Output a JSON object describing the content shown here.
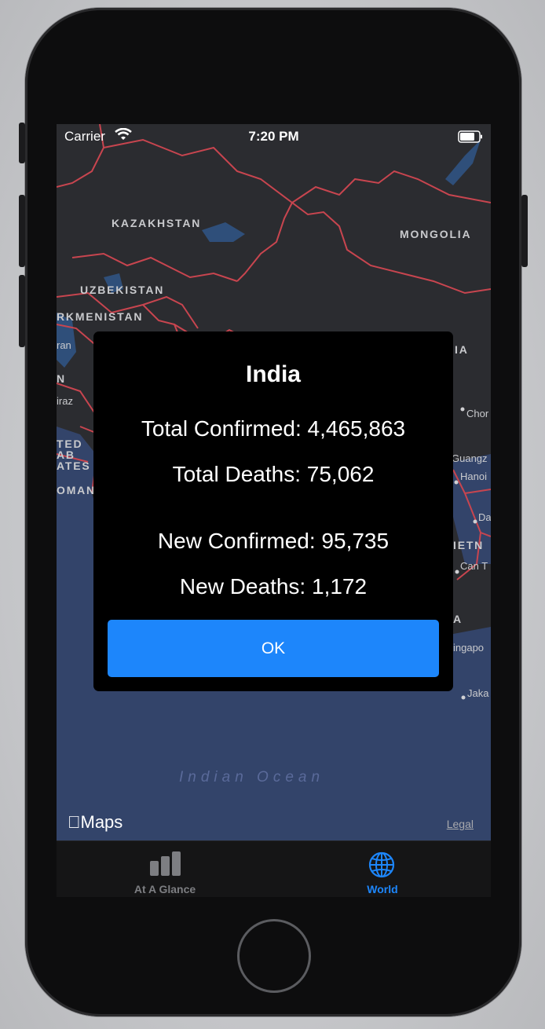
{
  "status_bar": {
    "carrier": "Carrier",
    "time": "7:20 PM"
  },
  "map": {
    "country_labels": [
      "KAZAKHSTAN",
      "MONGOLIA",
      "UZBEKISTAN",
      "RKMENISTAN",
      "IA",
      "N",
      "TED",
      "AB",
      "ATES",
      "OMAN",
      "A",
      "IETN"
    ],
    "city_labels": [
      "ran",
      "iraz",
      "Chor",
      "Guangz",
      "Hanoi",
      "Da",
      "Can T",
      "ingapo",
      "Jaka"
    ],
    "ocean_label": "Indian Ocean",
    "attribution": "Maps",
    "legal_label": "Legal",
    "colors": {
      "land": "#2b2c30",
      "water": "#33446a",
      "border": "#c8454f",
      "lake": "#2f4f7a"
    }
  },
  "alert": {
    "title": "India",
    "total_confirmed": "Total Confirmed: 4,465,863",
    "total_deaths": "Total Deaths: 75,062",
    "new_confirmed": "New Confirmed: 95,735",
    "new_deaths": "New Deaths: 1,172",
    "ok_label": "OK"
  },
  "tab_bar": {
    "tabs": [
      {
        "label": "At A Glance",
        "icon": "bar-chart-icon",
        "selected": false
      },
      {
        "label": "World",
        "icon": "globe-icon",
        "selected": true
      }
    ],
    "selected_color": "#1d86fb",
    "unselected_color": "#7d7e82"
  }
}
